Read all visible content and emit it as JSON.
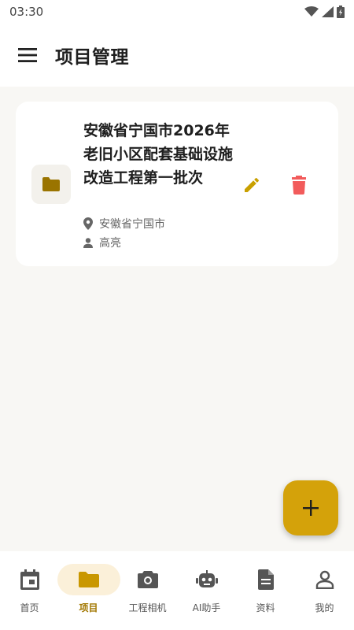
{
  "status_bar": {
    "time": "03:30",
    "icons": [
      "wifi-icon",
      "signal-icon",
      "battery-icon"
    ]
  },
  "app_bar": {
    "title": "项目管理",
    "menu_icon": "menu-icon"
  },
  "projects": [
    {
      "title": "安徽省宁国市2026年老旧小区配套基础设施改造工程第一批次",
      "location": "安徽省宁国市",
      "owner": "高亮",
      "icon": "folder-icon"
    }
  ],
  "fab": {
    "icon": "plus-icon"
  },
  "bottom_nav": {
    "items": [
      {
        "label": "首页",
        "icon": "calendar-icon",
        "active": false
      },
      {
        "label": "项目",
        "icon": "folder-icon",
        "active": true
      },
      {
        "label": "工程相机",
        "icon": "camera-icon",
        "active": false
      },
      {
        "label": "AI助手",
        "icon": "robot-icon",
        "active": false
      },
      {
        "label": "资料",
        "icon": "document-icon",
        "active": false
      },
      {
        "label": "我的",
        "icon": "person-icon",
        "active": false
      }
    ]
  },
  "colors": {
    "accent": "#d4a20a",
    "folder": "#9a7400",
    "edit": "#c9a000",
    "delete": "#f25b5b",
    "active_tab_bg": "#fbf0d9",
    "page_bg": "#f8f7f4"
  }
}
